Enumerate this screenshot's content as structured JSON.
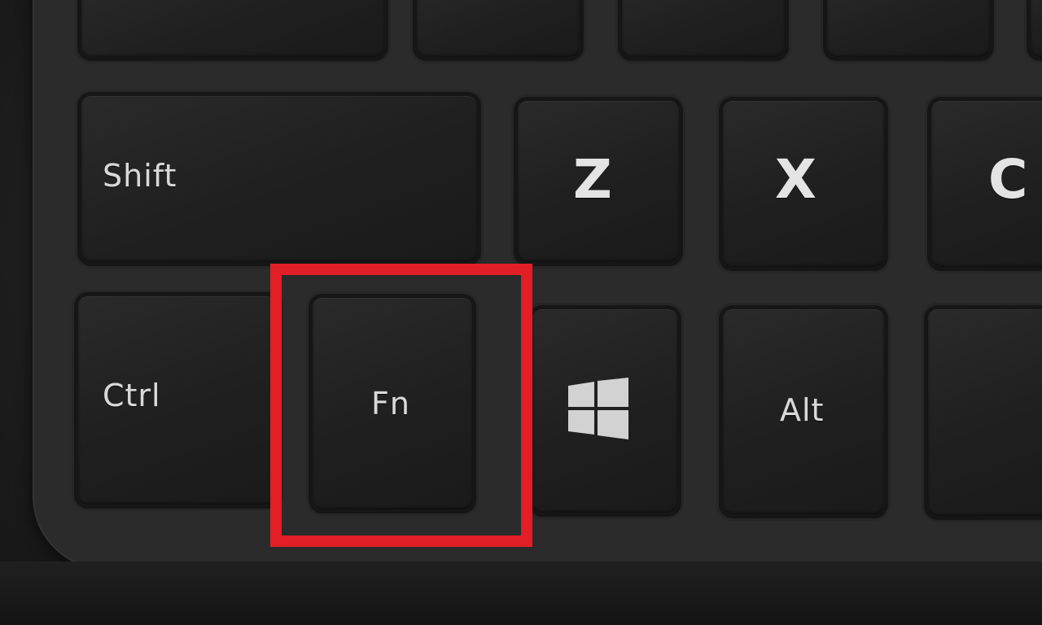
{
  "keys": {
    "shift": "Shift",
    "z": "Z",
    "x": "X",
    "c": "C",
    "ctrl": "Ctrl",
    "fn": "Fn",
    "alt": "Alt"
  },
  "icons": {
    "windows_key": "windows-logo-icon"
  },
  "colors": {
    "highlight": "#e21e26",
    "key_surface": "#1f1f1f",
    "legend": "#d9d9d9"
  }
}
